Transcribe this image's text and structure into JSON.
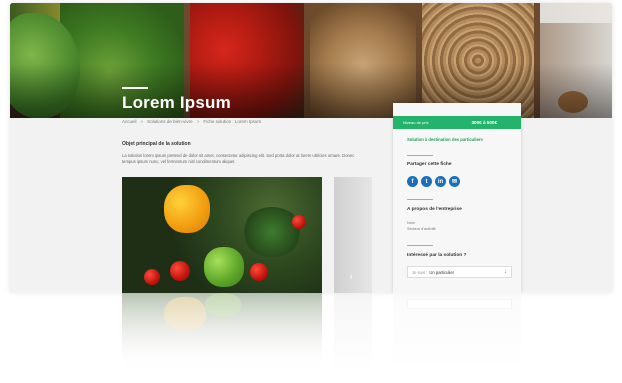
{
  "hero": {
    "title": "Lorem Ipsum"
  },
  "breadcrumb": [
    "Accueil",
    "Solutions de bien-vivre",
    "Fiche solution : Lorem Ipsum"
  ],
  "main": {
    "heading": "Objet principal de la solution",
    "paragraph": "La solution lorem ipsum pretend de dolor sit amet, consectetur adipiscing elit. Sed porta dolor at lorem ultricies ornare. Donec tempus ipsum nunc, vel fermentum nisl condimentum aliquet."
  },
  "sidebar": {
    "price_label": "Niveau de prix",
    "price_value": "300€ à 500€",
    "audience_link": "Solution à destination des particuliers",
    "share_heading": "Partager cette fiche",
    "share_icons": [
      "facebook-icon",
      "twitter-icon",
      "linkedin-icon",
      "email-icon"
    ],
    "share_glyphs": [
      "f",
      "t",
      "in",
      "✉"
    ],
    "about_heading": "A propos de l'entreprise",
    "about_lines": [
      "Nom",
      "Secteur d'activité"
    ],
    "interest_heading": "Intéressé par la solution ?",
    "select_prefix": "Je suis :",
    "select_value": "Un particulier"
  },
  "colors": {
    "accent": "#23b36a",
    "link_blue": "#1d6fb8"
  }
}
